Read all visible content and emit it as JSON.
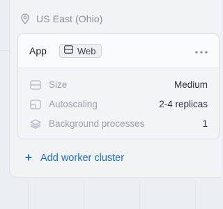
{
  "region": {
    "icon": "location-pin-icon",
    "name": "US East (Ohio)"
  },
  "app_card": {
    "title": "App",
    "badge": {
      "icon": "web-layout-icon",
      "label": "Web"
    },
    "more_icon": "more-horizontal-icon",
    "properties": [
      {
        "icon": "size-icon",
        "label": "Size",
        "value": "Medium"
      },
      {
        "icon": "autoscaling-icon",
        "label": "Autoscaling",
        "value": "2-4 replicas"
      },
      {
        "icon": "layers-icon",
        "label": "Background processes",
        "value": "1"
      }
    ]
  },
  "add_worker": {
    "icon": "plus-icon",
    "label": "Add worker cluster"
  },
  "colors": {
    "accent": "#1f6fc8",
    "muted_text": "#9aa1a8",
    "primary_text": "#202428"
  }
}
